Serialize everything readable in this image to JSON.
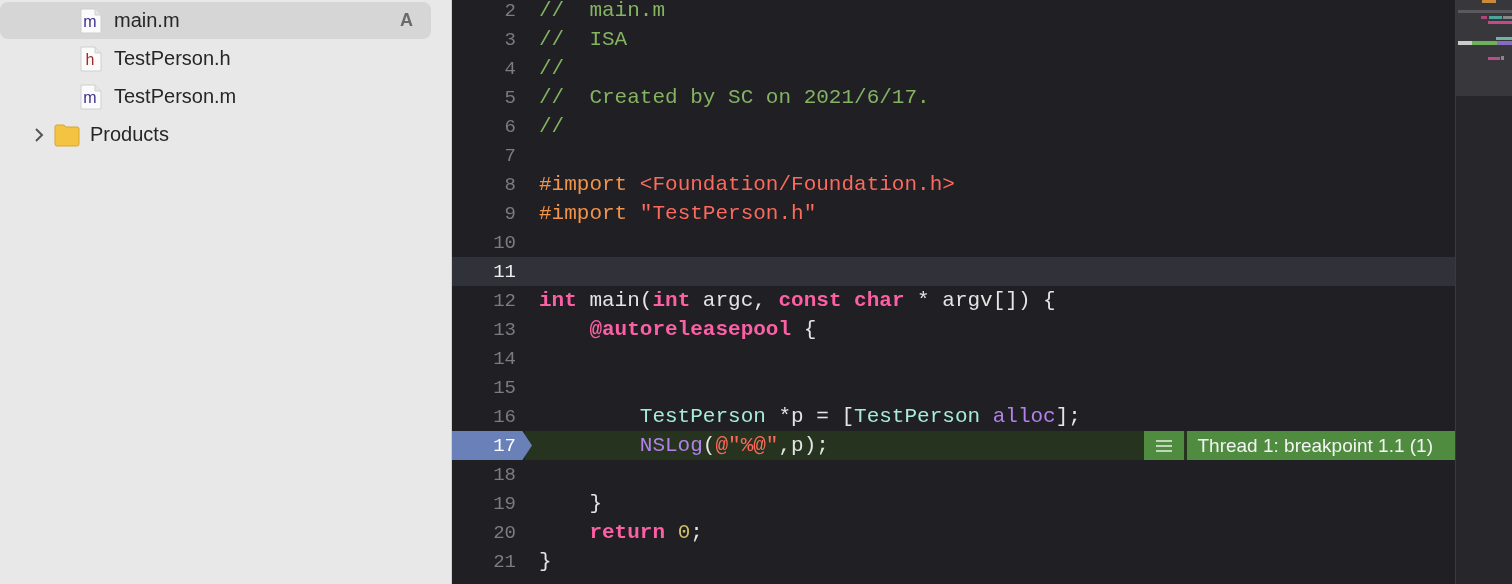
{
  "sidebar": {
    "items": [
      {
        "kind": "source",
        "icon_letter": "m",
        "name": "main.m",
        "badge": "A",
        "selected": true
      },
      {
        "kind": "header",
        "icon_letter": "h",
        "name": "TestPerson.h",
        "selected": false
      },
      {
        "kind": "source",
        "icon_letter": "m",
        "name": "TestPerson.m",
        "selected": false
      },
      {
        "kind": "group",
        "name": "Products",
        "expanded": false,
        "selected": false
      }
    ]
  },
  "editor": {
    "lines": [
      {
        "number": "2",
        "tokens": [
          {
            "kind": "comment",
            "text": "//  main.m"
          }
        ]
      },
      {
        "number": "3",
        "tokens": [
          {
            "kind": "comment",
            "text": "//  ISA"
          }
        ]
      },
      {
        "number": "4",
        "tokens": [
          {
            "kind": "comment",
            "text": "//"
          }
        ]
      },
      {
        "number": "5",
        "tokens": [
          {
            "kind": "comment",
            "text": "//  Created by SC on 2021/6/17."
          }
        ]
      },
      {
        "number": "6",
        "tokens": [
          {
            "kind": "comment",
            "text": "//"
          }
        ]
      },
      {
        "number": "7"
      },
      {
        "number": "8",
        "tokens": [
          {
            "kind": "preproc",
            "text": "#import "
          },
          {
            "kind": "string",
            "text": "<Foundation/Foundation.h>"
          }
        ]
      },
      {
        "number": "9",
        "tokens": [
          {
            "kind": "preproc",
            "text": "#import "
          },
          {
            "kind": "string",
            "text": "\"TestPerson.h\""
          }
        ]
      },
      {
        "number": "10"
      },
      {
        "number": "11",
        "current": true
      },
      {
        "number": "12",
        "tokens": [
          {
            "kind": "keyword",
            "text": "int"
          },
          {
            "kind": "plain",
            "text": " main("
          },
          {
            "kind": "keyword",
            "text": "int"
          },
          {
            "kind": "plain",
            "text": " argc, "
          },
          {
            "kind": "keyword",
            "text": "const char"
          },
          {
            "kind": "plain",
            "text": " * argv[]) {"
          }
        ]
      },
      {
        "number": "13",
        "tokens": [
          {
            "kind": "keyword",
            "text": "    @autoreleasepool"
          },
          {
            "kind": "plain",
            "text": " {"
          }
        ]
      },
      {
        "number": "14"
      },
      {
        "number": "15"
      },
      {
        "number": "16",
        "tokens": [
          {
            "kind": "type",
            "text": "        TestPerson"
          },
          {
            "kind": "plain",
            "text": " *p = ["
          },
          {
            "kind": "type",
            "text": "TestPerson "
          },
          {
            "kind": "method",
            "text": "alloc"
          },
          {
            "kind": "plain",
            "text": "];"
          }
        ]
      },
      {
        "number": "17",
        "tokens": [
          {
            "kind": "method",
            "text": "        NSLog"
          },
          {
            "kind": "plain",
            "text": "("
          },
          {
            "kind": "string",
            "text": "@\"%@\""
          },
          {
            "kind": "plain",
            "text": ",p);"
          }
        ],
        "breakpoint": true,
        "annotation": "Thread 1: breakpoint 1.1 (1)"
      },
      {
        "number": "18"
      },
      {
        "number": "19",
        "tokens": [
          {
            "kind": "plain",
            "text": "    }"
          }
        ]
      },
      {
        "number": "20",
        "tokens": [
          {
            "kind": "keyword",
            "text": "    return "
          },
          {
            "kind": "number",
            "text": "0"
          },
          {
            "kind": "plain",
            "text": ";"
          }
        ]
      },
      {
        "number": "21",
        "tokens": [
          {
            "kind": "plain",
            "text": "}"
          }
        ]
      }
    ]
  }
}
